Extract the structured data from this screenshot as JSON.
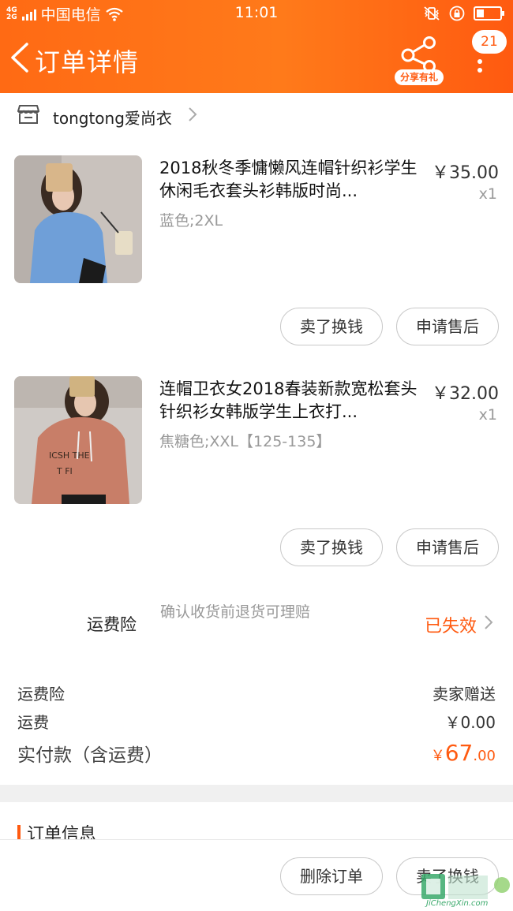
{
  "status_bar": {
    "network": "4G 2G",
    "carrier": "中国电信",
    "time": "11:01"
  },
  "header": {
    "title": "订单详情",
    "share_label": "分享有礼",
    "badge_count": "21",
    "accent_color": "#ff6a14"
  },
  "shop": {
    "name": "tongtong爱尚衣"
  },
  "products": [
    {
      "title": "2018秋冬季慵懒风连帽针织衫学生休闲毛衣套头衫韩版时尚...",
      "spec": "蓝色;2XL",
      "price": "￥35.00",
      "qty": "x1",
      "sell_label": "卖了换钱",
      "after_sale_label": "申请售后"
    },
    {
      "title": "连帽卫衣女2018春装新款宽松套头针织衫女韩版学生上衣打...",
      "spec": "焦糖色;XXL【125-135】",
      "price": "￥32.00",
      "qty": "x1",
      "sell_label": "卖了换钱",
      "after_sale_label": "申请售后"
    }
  ],
  "insurance": {
    "label": "运费险",
    "desc": "确认收货前退货可理赔",
    "status": "已失效"
  },
  "fees": {
    "insurance_label": "运费险",
    "insurance_value": "卖家赠送",
    "shipping_label": "运费",
    "shipping_value": "￥0.00",
    "total_label": "实付款（含运费）",
    "total_currency": "￥",
    "total_int": "67",
    "total_dec": ".00"
  },
  "order_info": {
    "title": "订单信息"
  },
  "bottom": {
    "delete_label": "删除订单",
    "sell_label": "卖了换钱"
  },
  "watermark": {
    "brand": "JiChengXin.com"
  }
}
